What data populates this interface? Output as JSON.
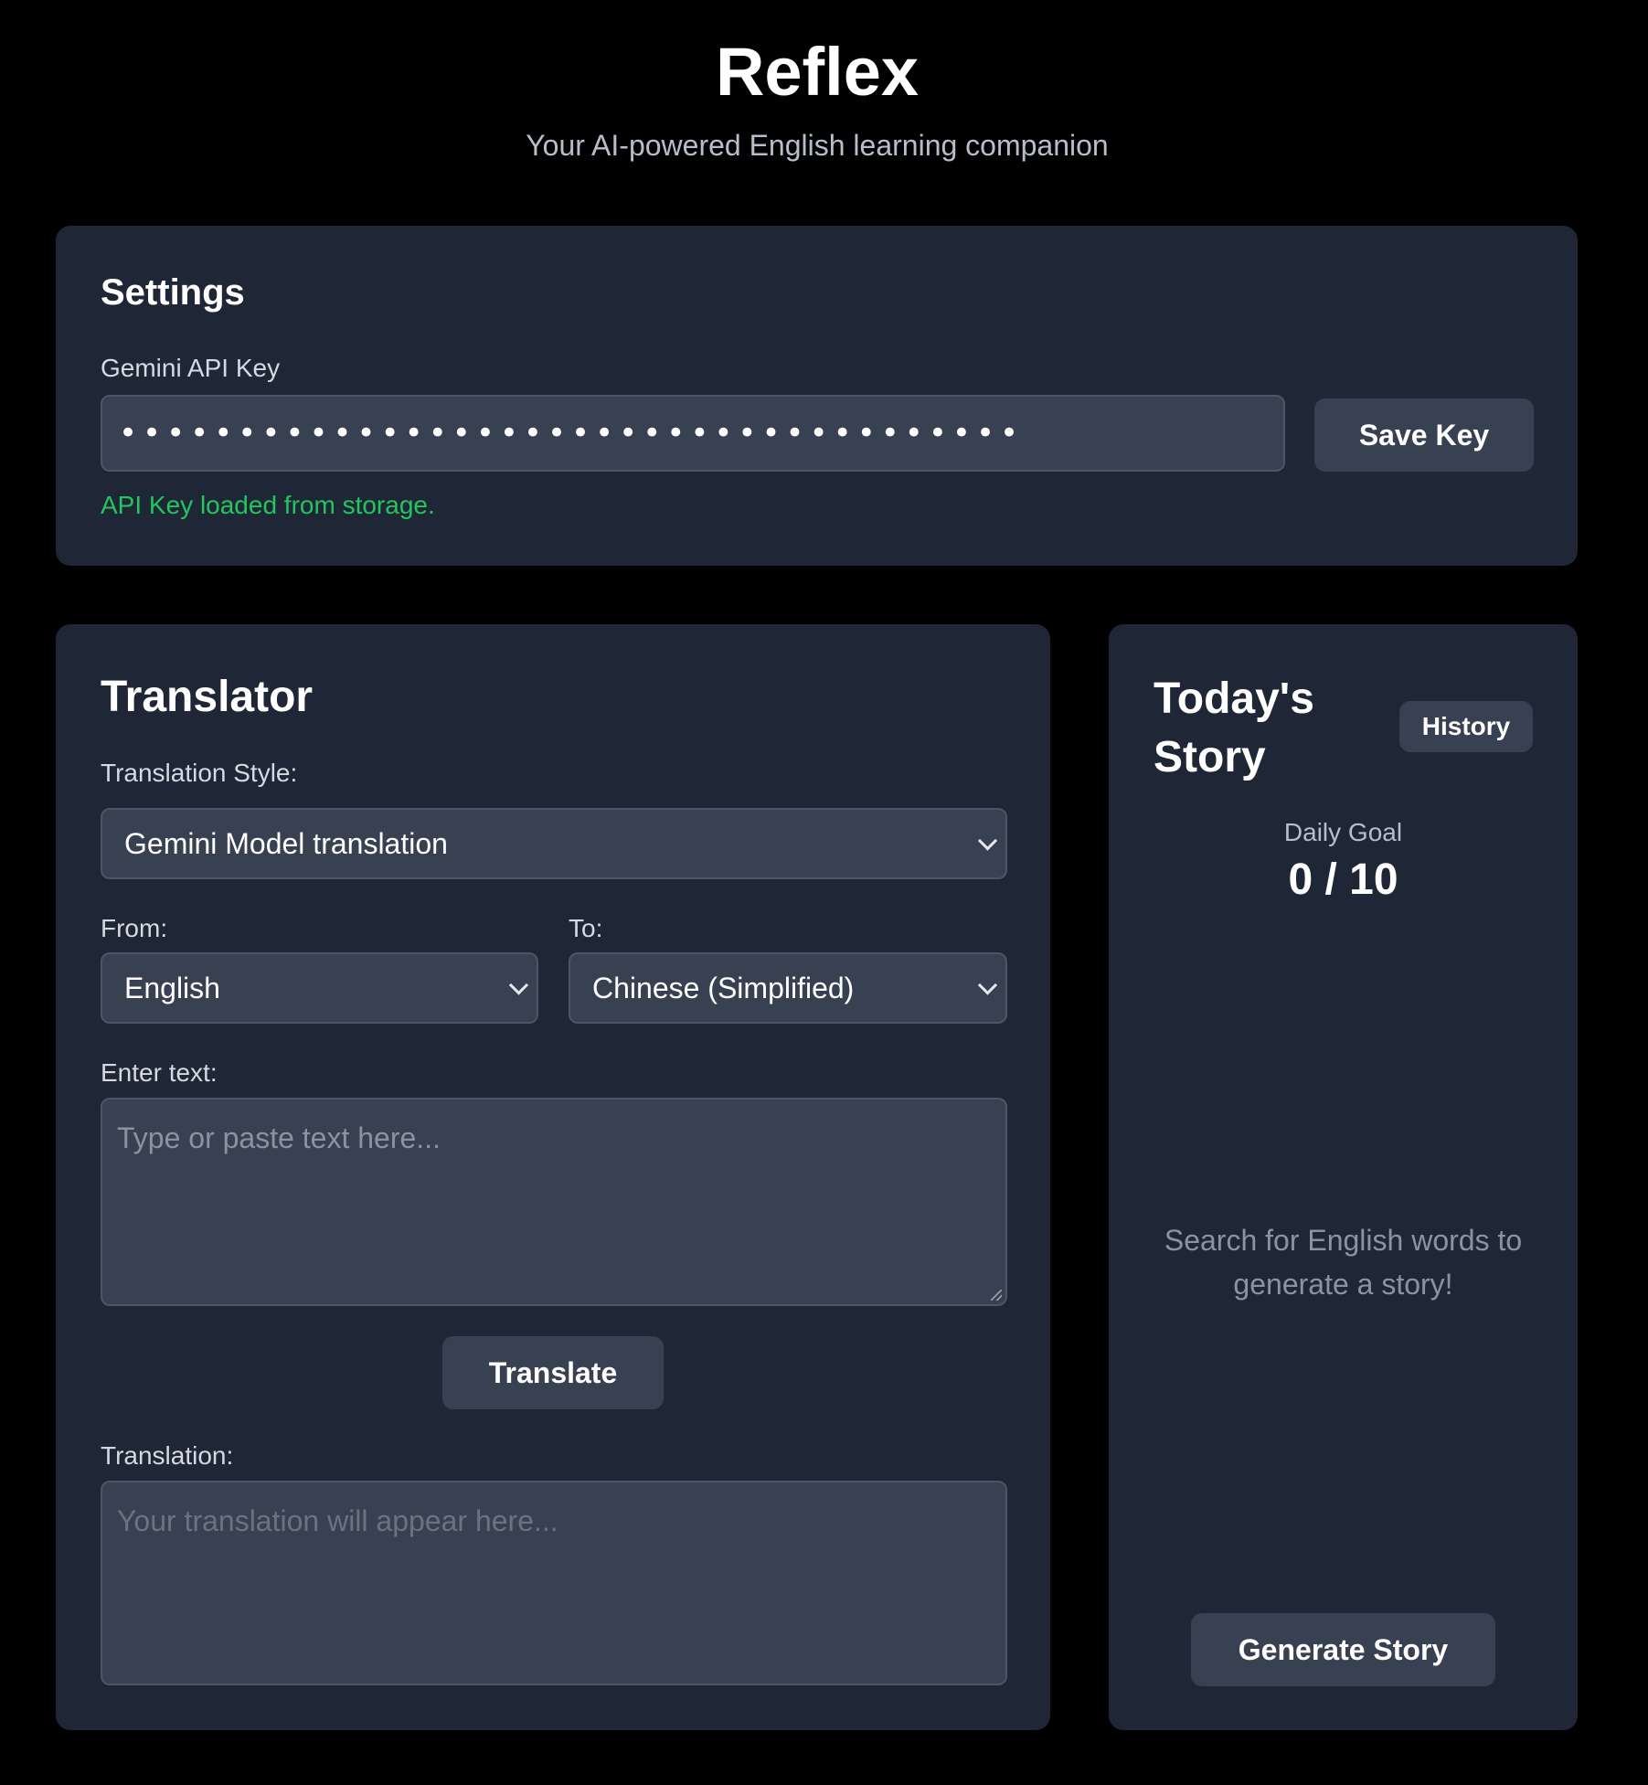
{
  "header": {
    "title": "Reflex",
    "subtitle": "Your AI-powered English learning companion"
  },
  "settings": {
    "title": "Settings",
    "api_key_label": "Gemini API Key",
    "api_key_value": "••••••••••••••••••••••••••••••••••••••",
    "save_label": "Save Key",
    "status": "API Key loaded from storage.",
    "status_color": "#22c55e"
  },
  "translator": {
    "title": "Translator",
    "style_label": "Translation Style:",
    "style_value": "Gemini Model translation",
    "from_label": "From:",
    "from_value": "English",
    "to_label": "To:",
    "to_value": "Chinese (Simplified)",
    "input_label": "Enter text:",
    "input_placeholder": "Type or paste text here...",
    "translate_label": "Translate",
    "output_label": "Translation:",
    "output_placeholder": "Your translation will appear here..."
  },
  "story": {
    "title": "Today's Story",
    "history_label": "History",
    "goal_label": "Daily Goal",
    "goal_value": "0 / 10",
    "empty_message": "Search for English words to generate a story!",
    "generate_label": "Generate Story"
  },
  "icons": {
    "dropdown": "chevron-down-icon",
    "resize": "resize-handle-icon"
  }
}
